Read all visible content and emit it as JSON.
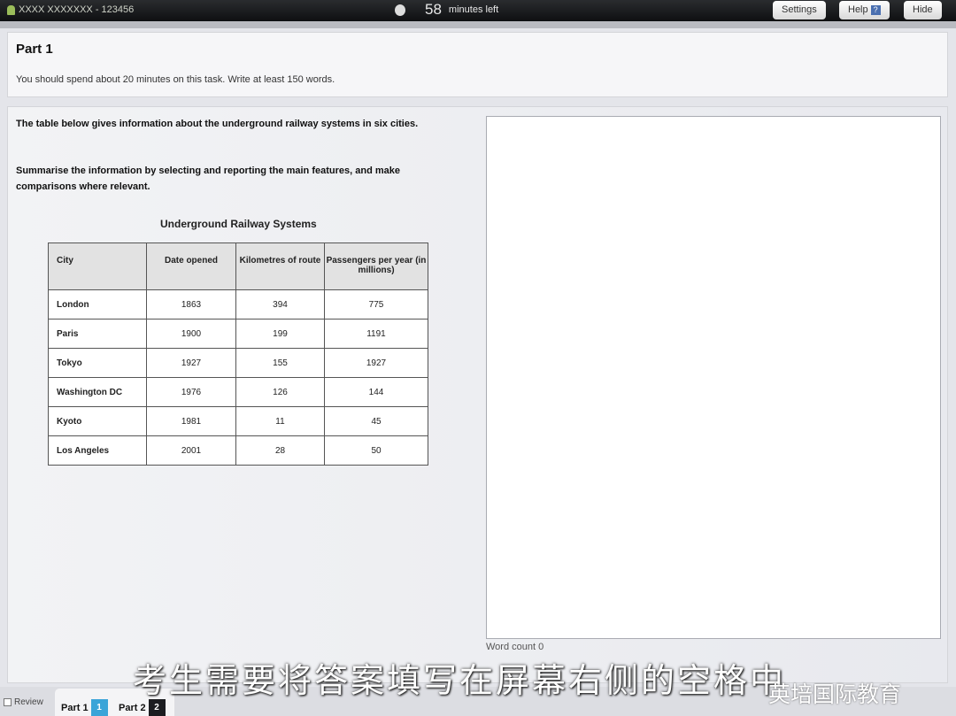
{
  "topbar": {
    "candidate": "XXXX XXXXXXX - 123456",
    "minutes": "58",
    "minutes_label": "minutes left",
    "settings": "Settings",
    "help": "Help",
    "help_icon": "?",
    "hide": "Hide"
  },
  "part": {
    "title": "Part 1",
    "instruction": "You should spend about 20 minutes on this task. Write at least 150 words."
  },
  "prompt": {
    "p1": "The table below gives information about the underground railway systems in six cities.",
    "p2": "Summarise the information by selecting and reporting the main features, and make comparisons where relevant."
  },
  "table": {
    "title": "Underground Railway Systems",
    "headers": [
      "City",
      "Date opened",
      "Kilometres of route",
      "Passengers per year (in millions)"
    ],
    "rows": [
      [
        "London",
        "1863",
        "394",
        "775"
      ],
      [
        "Paris",
        "1900",
        "199",
        "1191"
      ],
      [
        "Tokyo",
        "1927",
        "155",
        "1927"
      ],
      [
        "Washington DC",
        "1976",
        "126",
        "144"
      ],
      [
        "Kyoto",
        "1981",
        "11",
        "45"
      ],
      [
        "Los Angeles",
        "2001",
        "28",
        "50"
      ]
    ]
  },
  "answer": {
    "value": "",
    "word_count_label": "Word count",
    "word_count": "0"
  },
  "bottom": {
    "review": "Review",
    "part1": "Part 1",
    "part1_num": "1",
    "part2": "Part 2",
    "part2_num": "2"
  },
  "overlay": {
    "caption": "考生需要将答案填写在屏幕右侧的空格中",
    "watermark": "英培国际教育"
  }
}
